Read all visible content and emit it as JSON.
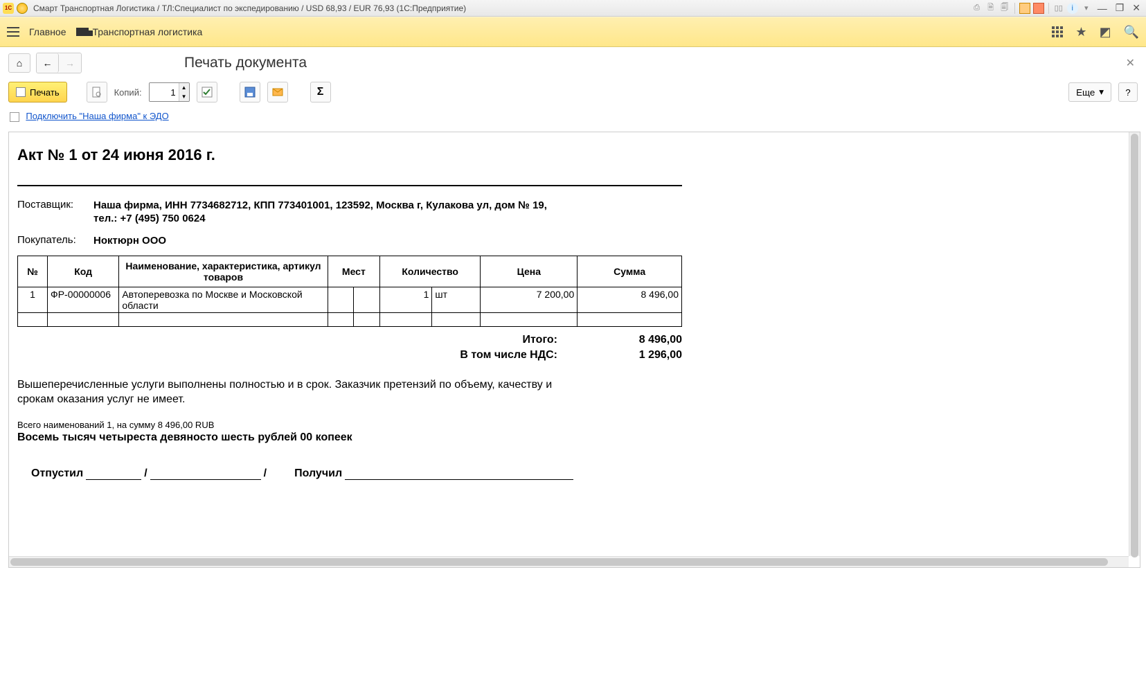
{
  "window": {
    "title": "Смарт Транспортная Логистика / ТЛ:Специалист по экспедированию / USD 68,93 / EUR 76,93  (1С:Предприятие)"
  },
  "main_menu": {
    "home": "Главное",
    "logistics": "Транспортная логистика"
  },
  "page": {
    "title": "Печать документа"
  },
  "toolbar": {
    "print_label": "Печать",
    "copies_label": "Копий:",
    "copies_value": "1",
    "more_label": "Еще",
    "help_label": "?"
  },
  "link": {
    "edo": "Подключить \"Наша фирма\" к ЭДО"
  },
  "doc": {
    "title": "Акт № 1 от 24 июня 2016 г.",
    "supplier_label": "Поставщик:",
    "supplier_value": "Наша фирма,  ИНН 7734682712,  КПП 773401001,  123592, Москва г, Кулакова ул, дом № 19,  тел.: +7 (495) 750 0624",
    "buyer_label": "Покупатель:",
    "buyer_value": "Ноктюрн ООО",
    "table": {
      "columns": {
        "num": "№",
        "code": "Код",
        "name": "Наименование, характеристика, артикул товаров",
        "places": "Мест",
        "qty": "Количество",
        "price": "Цена",
        "sum": "Сумма"
      },
      "rows": [
        {
          "num": "1",
          "code": "ФР-00000006",
          "name": "Автоперевозка по Москве и Московской области",
          "places": "",
          "qty": "1",
          "unit": "шт",
          "price": "7 200,00",
          "sum": "8 496,00"
        }
      ]
    },
    "totals": {
      "total_label": "Итого:",
      "total_value": "8 496,00",
      "vat_label": "В том числе НДС:",
      "vat_value": "1 296,00"
    },
    "disclaimer": "Вышеперечисленные услуги выполнены полностью и в срок. Заказчик претензий по объему, качеству и срокам оказания услуг не имеет.",
    "items_summary": "Всего наименований 1, на сумму 8 496,00 RUB",
    "sum_words": "Восемь тысяч четыреста девяносто шесть рублей 00 копеек",
    "signatures": {
      "shipped": "Отпустил",
      "slash": "/",
      "received": "Получил"
    }
  }
}
